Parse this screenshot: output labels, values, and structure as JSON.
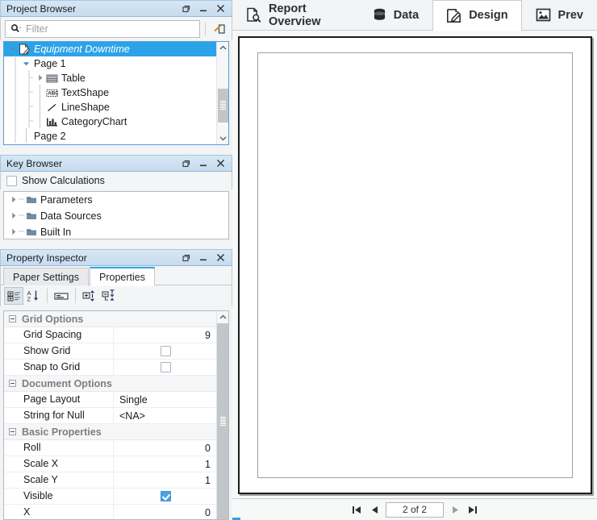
{
  "panels": {
    "project_browser": {
      "title": "Project Browser",
      "window_buttons": [
        "restore-icon",
        "minimize-icon",
        "close-icon"
      ],
      "filter": {
        "placeholder": "Filter",
        "value": "",
        "icon": "search-dropdown-icon",
        "action_icon": "link-node-icon"
      },
      "tree": [
        {
          "label": "Equipment Downtime",
          "icon": "report-document-icon",
          "depth": 0,
          "twisty": "expanded",
          "selected": true,
          "italic": true
        },
        {
          "label": "Page 1",
          "icon": "none",
          "depth": 1,
          "twisty": "expanded",
          "selected": false
        },
        {
          "label": "Table",
          "icon": "table-icon",
          "depth": 2,
          "twisty": "collapsed",
          "selected": false
        },
        {
          "label": "TextShape",
          "icon": "text-shape-icon",
          "depth": 2,
          "twisty": "none",
          "selected": false
        },
        {
          "label": "LineShape",
          "icon": "line-shape-icon",
          "depth": 2,
          "twisty": "none",
          "selected": false
        },
        {
          "label": "CategoryChart",
          "icon": "bar-chart-icon",
          "depth": 2,
          "twisty": "none",
          "selected": false
        },
        {
          "label": "Page 2",
          "icon": "none",
          "depth": 1,
          "twisty": "none",
          "selected": false
        }
      ]
    },
    "key_browser": {
      "title": "Key Browser",
      "show_calculations_label": "Show Calculations",
      "show_calculations_checked": false,
      "items": [
        {
          "label": "Parameters",
          "icon": "folder-icon",
          "twisty": "collapsed"
        },
        {
          "label": "Data Sources",
          "icon": "folder-icon",
          "twisty": "collapsed"
        },
        {
          "label": "Built In",
          "icon": "folder-icon",
          "twisty": "collapsed"
        }
      ]
    },
    "property_inspector": {
      "title": "Property Inspector",
      "tabs": [
        {
          "label": "Paper Settings",
          "active": false
        },
        {
          "label": "Properties",
          "active": true
        }
      ],
      "toolbar": [
        {
          "name": "categorized-view-icon",
          "pressed": true
        },
        {
          "name": "alphabetical-sort-icon",
          "pressed": false
        },
        {
          "name": "property-pages-icon",
          "pressed": false
        },
        {
          "name": "expand-all-icon",
          "pressed": false
        },
        {
          "name": "collapse-all-icon",
          "pressed": false
        }
      ],
      "groups": [
        {
          "name": "Grid Options",
          "rows": [
            {
              "name": "Grid Spacing",
              "value": "9",
              "type": "number"
            },
            {
              "name": "Show Grid",
              "value": "",
              "type": "checkbox",
              "checked": false
            },
            {
              "name": "Snap to Grid",
              "value": "",
              "type": "checkbox",
              "checked": false
            }
          ]
        },
        {
          "name": "Document Options",
          "rows": [
            {
              "name": "Page Layout",
              "value": "Single",
              "type": "text"
            },
            {
              "name": "String for Null",
              "value": "<NA>",
              "type": "text"
            }
          ]
        },
        {
          "name": "Basic Properties",
          "rows": [
            {
              "name": "Roll",
              "value": "0",
              "type": "number"
            },
            {
              "name": "Scale X",
              "value": "1",
              "type": "number"
            },
            {
              "name": "Scale Y",
              "value": "1",
              "type": "number"
            },
            {
              "name": "Visible",
              "value": "",
              "type": "checkbox",
              "checked": true
            },
            {
              "name": "X",
              "value": "0",
              "type": "number"
            }
          ]
        }
      ]
    }
  },
  "main": {
    "tabs": [
      {
        "label": "Report Overview",
        "icon": "document-search-icon",
        "active": false
      },
      {
        "label": "Data",
        "icon": "database-icon",
        "active": false
      },
      {
        "label": "Design",
        "icon": "design-pencil-icon",
        "active": true
      },
      {
        "label": "Prev",
        "icon": "preview-image-icon",
        "active": false
      }
    ],
    "pager": {
      "first_label": "first-page-icon",
      "prev_label": "previous-page-icon",
      "page_text": "2 of 2",
      "next_label": "next-page-icon",
      "last_label": "last-page-icon"
    }
  },
  "colors": {
    "accent": "#2ca3e8",
    "titlebar": "#cfe1f1",
    "selection": "#2ca3e8",
    "panel_bg": "#f2f3f4"
  }
}
